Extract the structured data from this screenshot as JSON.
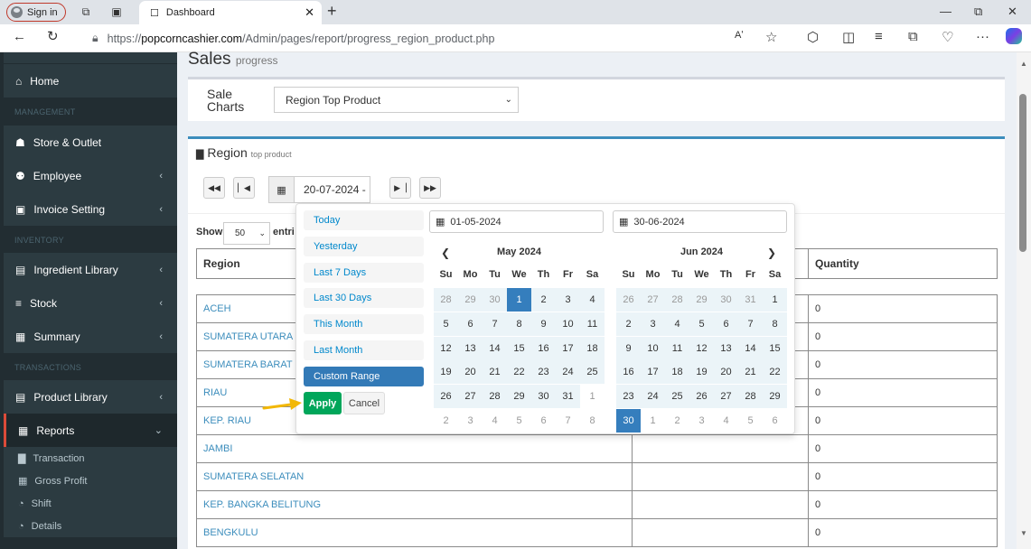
{
  "browser": {
    "signin_label": "Sign in",
    "tab_title": "Dashboard",
    "url_prefix": "https://",
    "url_domain": "popcorncashier.com",
    "url_path": "/Admin/pages/report/progress_region_product.php",
    "read_aloud": "Aʹ",
    "more": "···"
  },
  "sidebar": {
    "items": [
      {
        "label": "Home",
        "icon": "home-icon",
        "glyph": "⌂"
      },
      {
        "section": "MANAGEMENT"
      },
      {
        "label": "Store & Outlet",
        "icon": "bank-icon",
        "glyph": "☗"
      },
      {
        "label": "Employee",
        "icon": "users-icon",
        "glyph": "⚉",
        "chevron": "‹"
      },
      {
        "label": "Invoice Setting",
        "icon": "money-icon",
        "glyph": "▣",
        "chevron": "‹"
      },
      {
        "section": "INVENTORY"
      },
      {
        "label": "Ingredient Library",
        "icon": "book-icon",
        "glyph": "▤",
        "chevron": "‹"
      },
      {
        "label": "Stock",
        "icon": "database-icon",
        "glyph": "≡",
        "chevron": "‹"
      },
      {
        "label": "Summary",
        "icon": "table-icon",
        "glyph": "▦",
        "chevron": "‹"
      },
      {
        "section": "TRANSACTIONS"
      },
      {
        "label": "Product Library",
        "icon": "book-icon",
        "glyph": "▤",
        "chevron": "‹"
      },
      {
        "label": "Reports",
        "icon": "table-icon",
        "glyph": "▦",
        "chevron": "⌄"
      }
    ],
    "subitems": [
      {
        "label": "Transaction",
        "icon": "bar-chart-icon",
        "glyph": "▇"
      },
      {
        "label": "Gross Profit",
        "icon": "table-icon",
        "glyph": "▦"
      },
      {
        "label": "Shift",
        "icon": "pie-chart-icon",
        "glyph": "◔"
      },
      {
        "label": "Details",
        "icon": "pie-chart-icon",
        "glyph": "◔"
      }
    ]
  },
  "page": {
    "title": "Sales",
    "subtitle": "progress",
    "charts_label_line1": "Sale",
    "charts_label_line2": "Charts",
    "chart_select": "Region Top Product",
    "region_title": "Region",
    "region_subtitle": "top product",
    "date_display": "20-07-2024 -",
    "show_label": "Show",
    "entries_count": "50",
    "entries_label": "entri"
  },
  "table": {
    "headers": {
      "region": "Region",
      "quantity": "Quantity"
    },
    "rows": [
      {
        "region": "ACEH",
        "qty": "0"
      },
      {
        "region": "SUMATERA UTARA",
        "qty": "0"
      },
      {
        "region": "SUMATERA BARAT",
        "qty": "0"
      },
      {
        "region": "RIAU",
        "qty": "0"
      },
      {
        "region": "KEP. RIAU",
        "qty": "0"
      },
      {
        "region": "JAMBI",
        "qty": "0"
      },
      {
        "region": "SUMATERA SELATAN",
        "qty": "0"
      },
      {
        "region": "KEP. BANGKA BELITUNG",
        "qty": "0"
      },
      {
        "region": "BENGKULU",
        "qty": "0"
      }
    ]
  },
  "picker": {
    "ranges": [
      "Today",
      "Yesterday",
      "Last 7 Days",
      "Last 30 Days",
      "This Month",
      "Last Month",
      "Custom Range"
    ],
    "active_range": "Custom Range",
    "start_input": "01-05-2024",
    "end_input": "30-06-2024",
    "apply_label": "Apply",
    "cancel_label": "Cancel",
    "weekdays": [
      "Su",
      "Mo",
      "Tu",
      "We",
      "Th",
      "Fr",
      "Sa"
    ],
    "prev_glyph": "❮",
    "next_glyph": "❯",
    "calendars": [
      {
        "month": "May 2024",
        "days": [
          "28",
          "29",
          "30",
          "1",
          "2",
          "3",
          "4",
          "5",
          "6",
          "7",
          "8",
          "9",
          "10",
          "11",
          "12",
          "13",
          "14",
          "15",
          "16",
          "17",
          "18",
          "19",
          "20",
          "21",
          "22",
          "23",
          "24",
          "25",
          "26",
          "27",
          "28",
          "29",
          "30",
          "31",
          "1",
          "2",
          "3",
          "4",
          "5",
          "6",
          "7",
          "8"
        ],
        "states": [
          "offin",
          "offin",
          "offin",
          "sel",
          "inr",
          "inr",
          "inr",
          "inr",
          "inr",
          "inr",
          "inr",
          "inr",
          "inr",
          "inr",
          "inr",
          "inr",
          "inr",
          "inr",
          "inr",
          "inr",
          "inr",
          "inr",
          "inr",
          "inr",
          "inr",
          "inr",
          "inr",
          "inr",
          "inr",
          "inr",
          "inr",
          "inr",
          "inr",
          "inr",
          "off",
          "off",
          "off",
          "off",
          "off",
          "off",
          "off",
          "off"
        ]
      },
      {
        "month": "Jun 2024",
        "days": [
          "26",
          "27",
          "28",
          "29",
          "30",
          "31",
          "1",
          "2",
          "3",
          "4",
          "5",
          "6",
          "7",
          "8",
          "9",
          "10",
          "11",
          "12",
          "13",
          "14",
          "15",
          "16",
          "17",
          "18",
          "19",
          "20",
          "21",
          "22",
          "23",
          "24",
          "25",
          "26",
          "27",
          "28",
          "29",
          "30",
          "1",
          "2",
          "3",
          "4",
          "5",
          "6"
        ],
        "states": [
          "offin",
          "offin",
          "offin",
          "offin",
          "offin",
          "offin",
          "inr",
          "inr",
          "inr",
          "inr",
          "inr",
          "inr",
          "inr",
          "inr",
          "inr",
          "inr",
          "inr",
          "inr",
          "inr",
          "inr",
          "inr",
          "inr",
          "inr",
          "inr",
          "inr",
          "inr",
          "inr",
          "inr",
          "inr",
          "inr",
          "inr",
          "inr",
          "inr",
          "inr",
          "inr",
          "sel",
          "off",
          "off",
          "off",
          "off",
          "off",
          "off"
        ]
      }
    ]
  },
  "colors": {
    "sidebar": "#222d32",
    "accent": "#3c8dbc",
    "apply": "#00a65a",
    "selected": "#357ebd",
    "arrow": "#f2b705"
  }
}
